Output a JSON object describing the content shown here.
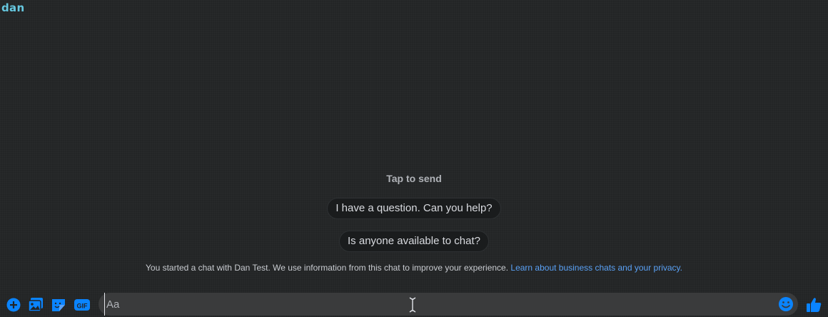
{
  "header": {
    "name": "dan"
  },
  "suggestions": {
    "title": "Tap to send",
    "chips": [
      "I have a question. Can you help?",
      "Is anyone available to chat?"
    ]
  },
  "disclaimer": {
    "text": "You started a chat with Dan Test. We use information from this chat to improve your experience.",
    "link": "Learn about business chats and your privacy."
  },
  "composer": {
    "placeholder": "Aa",
    "value": "",
    "icons": [
      "plus-circle-icon",
      "photo-icon",
      "sticker-icon",
      "gif-icon",
      "emoji-icon",
      "thumbs-up-icon"
    ],
    "gif_label": "GIF"
  },
  "colors": {
    "accent": "#0a84ff",
    "header_name": "#66c8e0",
    "link": "#5aa1f5",
    "background": "#232526",
    "input_bg": "#3a3b3c"
  }
}
